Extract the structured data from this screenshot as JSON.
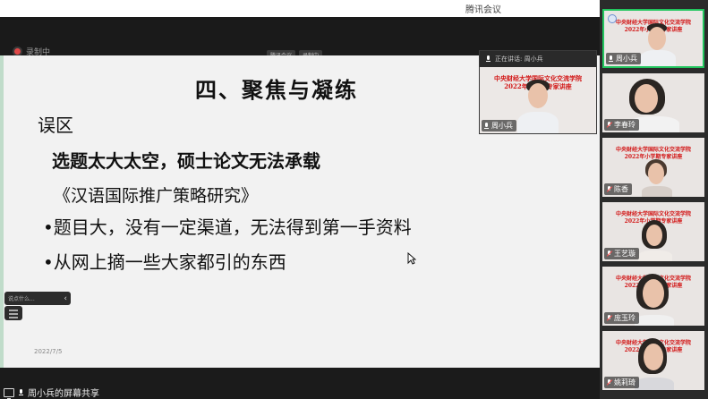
{
  "app": {
    "title": "腾讯会议"
  },
  "recording": {
    "label": "录制中"
  },
  "meeting_tabs": [
    "腾讯会议",
    "录制中"
  ],
  "speaker_bar": {
    "label": "正在讲话: 周小兵"
  },
  "slide": {
    "title": "四、聚焦与凝练",
    "lines": [
      "误区",
      "选题太大太空，硕士论文无法承载",
      "《汉语国际推广策略研究》",
      "•题目大，没有一定渠道，无法得到第一手资料",
      "•从网上摘一些大家都引的东西"
    ],
    "date": "2022/7/5"
  },
  "floating_toolbar": {
    "placeholder": "说点什么..."
  },
  "banner": {
    "line1": "中央财经大学国际文化交流学院",
    "line2": "2022年小学期专家讲座"
  },
  "speaker": {
    "name": "周小兵"
  },
  "participants": [
    {
      "name": "周小兵",
      "muted": false,
      "active": true
    },
    {
      "name": "李春玲",
      "muted": true,
      "active": false
    },
    {
      "name": "陈香",
      "muted": true,
      "active": false
    },
    {
      "name": "王艺璇",
      "muted": true,
      "active": false
    },
    {
      "name": "庞玉玲",
      "muted": true,
      "active": false
    },
    {
      "name": "姚莉琦",
      "muted": true,
      "active": false
    }
  ],
  "share": {
    "label": "周小兵的屏幕共享"
  },
  "colors": {
    "active_border": "#22c55e",
    "banner_red": "#d21515",
    "muted": "#ff4d4d"
  }
}
